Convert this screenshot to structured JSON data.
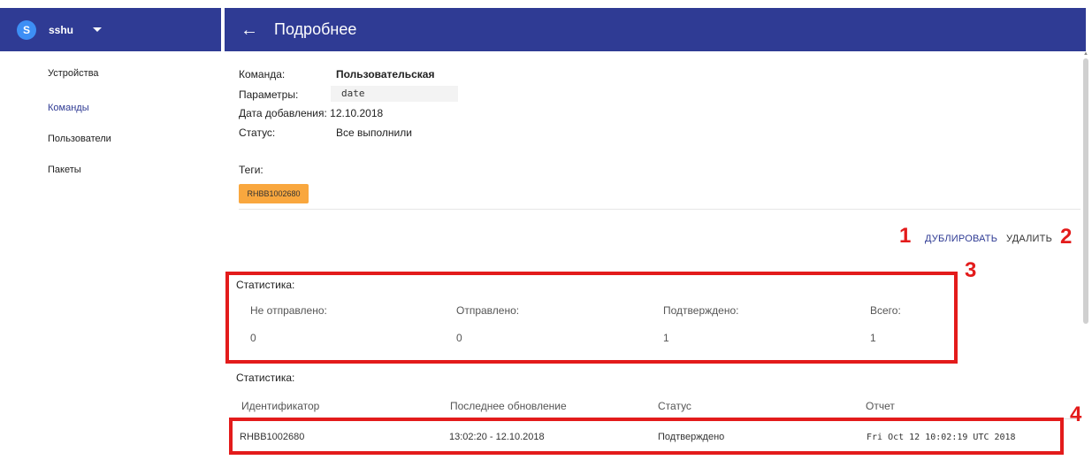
{
  "user": {
    "initial": "S",
    "name": "sshu"
  },
  "header": {
    "title": "Подробнее"
  },
  "sidebar": {
    "items": [
      {
        "label": "Устройства"
      },
      {
        "label": "Команды"
      },
      {
        "label": "Пользователи"
      },
      {
        "label": "Пакеты"
      }
    ]
  },
  "details": {
    "command_label": "Команда:",
    "command_value": "Пользовательская",
    "params_label": "Параметры:",
    "params_value": "date",
    "added_label": "Дата добавления:",
    "added_value": "12.10.2018",
    "status_label": "Статус:",
    "status_value": "Все выполнили",
    "tags_label": "Теги:",
    "tag": "RHBB1002680"
  },
  "actions": {
    "duplicate": "ДУБЛИРОВАТЬ",
    "delete": "УДАЛИТЬ"
  },
  "stats": {
    "title": "Статистика:",
    "columns": [
      "Не отправлено:",
      "Отправлено:",
      "Подтверждено:",
      "Всего:"
    ],
    "values": [
      "0",
      "0",
      "1",
      "1"
    ]
  },
  "devices": {
    "title": "Статистика:",
    "headers": [
      "Идентификатор",
      "Последнее обновление",
      "Статус",
      "Отчет"
    ],
    "rows": [
      [
        "RHBB1002680",
        "13:02:20 - 12.10.2018",
        "Подтверждено",
        "Fri Oct 12 10:02:19 UTC 2018"
      ]
    ]
  },
  "annotations": [
    "1",
    "2",
    "3",
    "4"
  ],
  "colors": {
    "appbar": "#2f3b94",
    "tag": "#f9a73e",
    "annotation": "#e31b1b"
  }
}
